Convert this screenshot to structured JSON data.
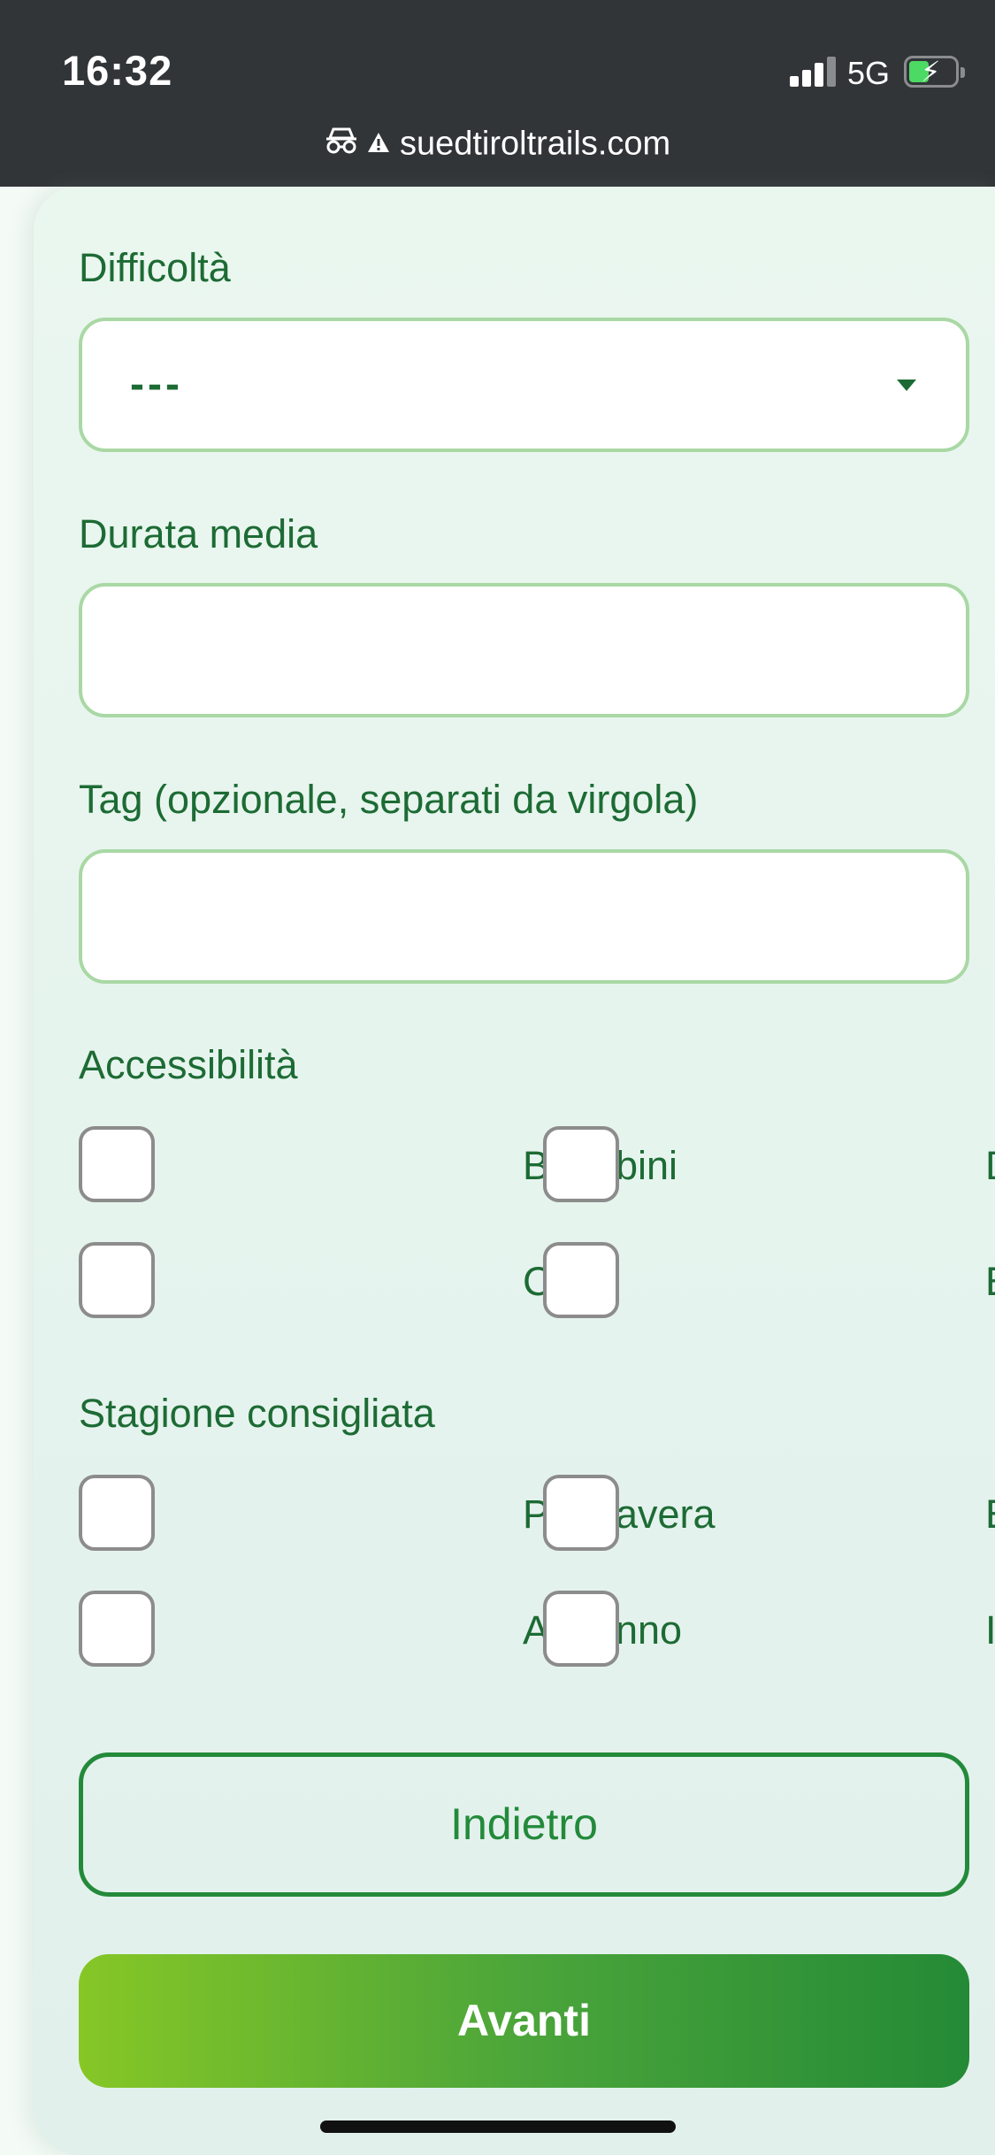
{
  "status_bar": {
    "time": "16:32",
    "network": "5G",
    "url": "suedtiroltrails.com"
  },
  "form": {
    "difficulty": {
      "label": "Difficoltà",
      "value": "---"
    },
    "duration": {
      "label": "Durata media",
      "value": ""
    },
    "tags": {
      "label": "Tag (opzionale, separati da virgola)",
      "value": ""
    },
    "accessibility": {
      "label": "Accessibilità",
      "options": [
        "",
        "B",
        "bini",
        "D",
        "",
        "C",
        "",
        "E"
      ]
    },
    "season": {
      "label": "Stagione consigliata",
      "options": [
        "",
        "P",
        "avera",
        "E",
        "",
        "A",
        "nno",
        "I"
      ]
    }
  },
  "buttons": {
    "back": "Indietro",
    "next": "Avanti"
  },
  "colors": {
    "accent": "#1d6b34",
    "field_border": "#a9d8a4",
    "status_bar": "#323538"
  }
}
